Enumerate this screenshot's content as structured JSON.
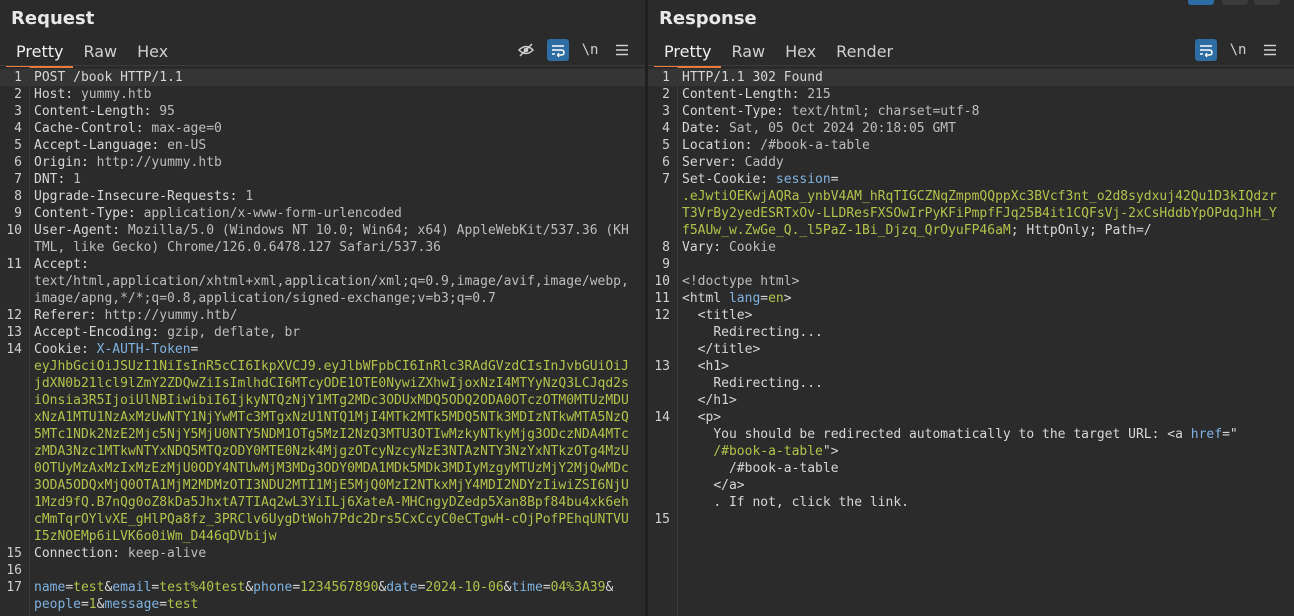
{
  "request": {
    "title": "Request",
    "tabs": [
      "Pretty",
      "Raw",
      "Hex"
    ],
    "newline_toggle": "\\n",
    "lines": [
      {
        "n": "1",
        "parts": [
          {
            "t": "POST /book HTTP/1.1",
            "c": "hn"
          }
        ]
      },
      {
        "n": "2",
        "parts": [
          {
            "t": "Host: ",
            "c": "hn"
          },
          {
            "t": "yummy.htb",
            "c": "hv"
          }
        ]
      },
      {
        "n": "3",
        "parts": [
          {
            "t": "Content-Length: ",
            "c": "hn"
          },
          {
            "t": "95",
            "c": "hv"
          }
        ]
      },
      {
        "n": "4",
        "parts": [
          {
            "t": "Cache-Control: ",
            "c": "hn"
          },
          {
            "t": "max-age=0",
            "c": "hv"
          }
        ]
      },
      {
        "n": "5",
        "parts": [
          {
            "t": "Accept-Language: ",
            "c": "hn"
          },
          {
            "t": "en-US",
            "c": "hv"
          }
        ]
      },
      {
        "n": "6",
        "parts": [
          {
            "t": "Origin: ",
            "c": "hn"
          },
          {
            "t": "http://yummy.htb",
            "c": "hv"
          }
        ]
      },
      {
        "n": "7",
        "parts": [
          {
            "t": "DNT: ",
            "c": "hn"
          },
          {
            "t": "1",
            "c": "hv"
          }
        ]
      },
      {
        "n": "8",
        "parts": [
          {
            "t": "Upgrade-Insecure-Requests: ",
            "c": "hn"
          },
          {
            "t": "1",
            "c": "hv"
          }
        ]
      },
      {
        "n": "9",
        "parts": [
          {
            "t": "Content-Type: ",
            "c": "hn"
          },
          {
            "t": "application/x-www-form-urlencoded",
            "c": "hv"
          }
        ]
      },
      {
        "n": "10",
        "parts": [
          {
            "t": "User-Agent: ",
            "c": "hn"
          },
          {
            "t": "Mozilla/5.0 (Windows NT 10.0; Win64; x64) AppleWebKit/537.36 (KHTML, like Gecko) Chrome/126.0.6478.127 Safari/537.36",
            "c": "hv"
          }
        ]
      },
      {
        "n": "11",
        "parts": [
          {
            "t": "Accept:\n",
            "c": "hn"
          },
          {
            "t": "text/html,application/xhtml+xml,application/xml;q=0.9,image/avif,image/webp,image/apng,*/*;q=0.8,application/signed-exchange;v=b3;q=0.7",
            "c": "hv"
          }
        ]
      },
      {
        "n": "12",
        "parts": [
          {
            "t": "Referer: ",
            "c": "hn"
          },
          {
            "t": "http://yummy.htb/",
            "c": "hv"
          }
        ]
      },
      {
        "n": "13",
        "parts": [
          {
            "t": "Accept-Encoding: ",
            "c": "hn"
          },
          {
            "t": "gzip, deflate, br",
            "c": "hv"
          }
        ]
      },
      {
        "n": "14",
        "parts": [
          {
            "t": "Cookie: ",
            "c": "hn"
          },
          {
            "t": "X-AUTH-Token",
            "c": "kp"
          },
          {
            "t": "=\n",
            "c": "hn"
          },
          {
            "t": "eyJhbGciOiJSUzI1NiIsInR5cCI6IkpXVCJ9.eyJlbWFpbCI6InRlc3RAdGVzdCIsInJvbGUiOiJjdXN0b21lcl9lZmY2ZDQwZiIsImlhdCI6MTcyODE1OTE0NywiZXhwIjoxNzI4MTYyNzQ3LCJqd2siOnsia3R5IjoiUlNBIiwibiI6IjkyNTQzNjY1MTg2MDc3ODUxMDQ5ODQ2ODA0OTczOTM0MTUzMDUxNzA1MTU1NzAxMzUwNTY1NjYwMTc3MTgxNzU1NTQ1MjI4MTk2MTk5MDQ5NTk3MDIzNTkwMTA5NzQ5MTc1NDk2NzE2Mjc5NjY5MjU0NTY5NDM1OTg5MzI2NzQ3MTU3OTIwMzkyNTkyMjg3ODczNDA4MTczMDA3Nzc1MTkwNTYxNDQ5MTQzODY0MTE0Nzk4MjgzOTcyNzcyNzE3NTAzNTY3NzYxNTkzOTg4MzU0OTUyMzAxMzIxMzEzMjU0ODY4NTUwMjM3MDg3ODY0MDA1MDk5MDk3MDIyMzgyMTUzMjY2MjQwMDc3ODA5ODQxMjQ0OTA1MjM2MDMzOTI3NDU2MTI1MjE5MjQ0MzI2NTkxMjY4MDI2NDYzIiwiZSI6NjU1Mzd9fQ.B7nQg0oZ8kDa5JhxtA7TIAq2wL3YiILj6XateA-MHCngyDZedp5Xan8Bpf84bu4xk6ehcMmTqrOYlvXE_gHlPQa8fz_3PRClv6UygDtWoh7Pdc2Drs5CxCcyC0eCTgwH-cOjPofPEhqUNTVUI5zNOEMp6iLVK6o0iWm_D446qDVbijw",
            "c": "vp"
          }
        ]
      },
      {
        "n": "15",
        "parts": [
          {
            "t": "Connection: ",
            "c": "hn"
          },
          {
            "t": "keep-alive",
            "c": "hv"
          }
        ]
      },
      {
        "n": "16",
        "parts": [
          {
            "t": "",
            "c": "hn"
          }
        ]
      },
      {
        "n": "17",
        "parts": [
          {
            "t": "name",
            "c": "kp"
          },
          {
            "t": "=",
            "c": "hn"
          },
          {
            "t": "test",
            "c": "vp"
          },
          {
            "t": "&",
            "c": "hn"
          },
          {
            "t": "email",
            "c": "kp"
          },
          {
            "t": "=",
            "c": "hn"
          },
          {
            "t": "test%40test",
            "c": "vp"
          },
          {
            "t": "&",
            "c": "hn"
          },
          {
            "t": "phone",
            "c": "kp"
          },
          {
            "t": "=",
            "c": "hn"
          },
          {
            "t": "1234567890",
            "c": "vp"
          },
          {
            "t": "&",
            "c": "hn"
          },
          {
            "t": "date",
            "c": "kp"
          },
          {
            "t": "=",
            "c": "hn"
          },
          {
            "t": "2024-10-06",
            "c": "vp"
          },
          {
            "t": "&",
            "c": "hn"
          },
          {
            "t": "time",
            "c": "kp"
          },
          {
            "t": "=",
            "c": "hn"
          },
          {
            "t": "04%3A39",
            "c": "vp"
          },
          {
            "t": "&\n",
            "c": "hn"
          },
          {
            "t": "people",
            "c": "kp"
          },
          {
            "t": "=",
            "c": "hn"
          },
          {
            "t": "1",
            "c": "vp"
          },
          {
            "t": "&",
            "c": "hn"
          },
          {
            "t": "message",
            "c": "kp"
          },
          {
            "t": "=",
            "c": "hn"
          },
          {
            "t": "test",
            "c": "vp"
          }
        ]
      }
    ]
  },
  "response": {
    "title": "Response",
    "tabs": [
      "Pretty",
      "Raw",
      "Hex",
      "Render"
    ],
    "newline_toggle": "\\n",
    "lines": [
      {
        "n": "1",
        "parts": [
          {
            "t": "HTTP/1.1 302 Found",
            "c": "hn"
          }
        ]
      },
      {
        "n": "2",
        "parts": [
          {
            "t": "Content-Length: ",
            "c": "hn"
          },
          {
            "t": "215",
            "c": "hv"
          }
        ]
      },
      {
        "n": "3",
        "parts": [
          {
            "t": "Content-Type: ",
            "c": "hn"
          },
          {
            "t": "text/html; charset=utf-8",
            "c": "hv"
          }
        ]
      },
      {
        "n": "4",
        "parts": [
          {
            "t": "Date: ",
            "c": "hn"
          },
          {
            "t": "Sat, 05 Oct 2024 20:18:05 GMT",
            "c": "hv"
          }
        ]
      },
      {
        "n": "5",
        "parts": [
          {
            "t": "Location: ",
            "c": "hn"
          },
          {
            "t": "/#book-a-table",
            "c": "hv"
          }
        ]
      },
      {
        "n": "6",
        "parts": [
          {
            "t": "Server: ",
            "c": "hn"
          },
          {
            "t": "Caddy",
            "c": "hv"
          }
        ]
      },
      {
        "n": "7",
        "parts": [
          {
            "t": "Set-Cookie: ",
            "c": "hn"
          },
          {
            "t": "session",
            "c": "kp"
          },
          {
            "t": "=\n",
            "c": "hn"
          },
          {
            "t": ".eJwtiOEKwjAQRa_ynbV4AM_hRqTIGCZNqZmpmQQppXc3BVcf3nt_o2d8sydxuj42Qu1D3kIQdzrT3VrBy2yedESRTxOv-LLDResFXSOwIrPyKFiPmpfFJq25B4it1CQFsVj-2xCsHddbYpOPdqJhH_Yf5AUw_w.ZwGe_Q._l5PaZ-1Bi_Djzq_QrOyuFP46aM",
            "c": "vp"
          },
          {
            "t": "; HttpOnly; Path=/",
            "c": "hn"
          }
        ]
      },
      {
        "n": "8",
        "parts": [
          {
            "t": "Vary: ",
            "c": "hn"
          },
          {
            "t": "Cookie",
            "c": "hv"
          }
        ]
      },
      {
        "n": "9",
        "parts": [
          {
            "t": "",
            "c": "hn"
          }
        ]
      },
      {
        "n": "10",
        "parts": [
          {
            "t": "<!doctype html>",
            "c": "hv"
          }
        ]
      },
      {
        "n": "11",
        "parts": [
          {
            "t": "<html ",
            "c": "tg"
          },
          {
            "t": "lang",
            "c": "an"
          },
          {
            "t": "=",
            "c": "tg"
          },
          {
            "t": "en",
            "c": "av"
          },
          {
            "t": ">",
            "c": "tg"
          }
        ]
      },
      {
        "n": "12",
        "parts": [
          {
            "t": "  <title>\n    Redirecting...\n  </title>",
            "c": "tg"
          }
        ]
      },
      {
        "n": "13",
        "parts": [
          {
            "t": "  <h1>\n    Redirecting...\n  </h1>",
            "c": "tg"
          }
        ]
      },
      {
        "n": "14",
        "parts": [
          {
            "t": "  <p>\n    You should be redirected automatically to the target URL: <",
            "c": "tg"
          },
          {
            "t": "a ",
            "c": "tg"
          },
          {
            "t": "href",
            "c": "an"
          },
          {
            "t": "=\"\n    ",
            "c": "tg"
          },
          {
            "t": "/#book-a-table",
            "c": "av"
          },
          {
            "t": "\">\n      /#book-a-table\n    </a>\n    . If not, click the link.",
            "c": "tg"
          }
        ]
      },
      {
        "n": "15",
        "parts": [
          {
            "t": "",
            "c": "hn"
          }
        ]
      }
    ]
  }
}
